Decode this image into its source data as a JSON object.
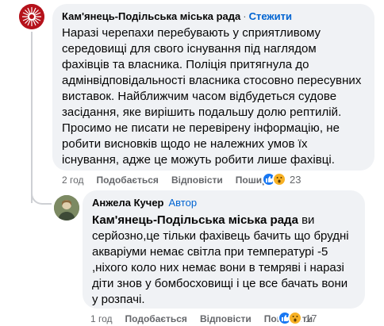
{
  "comment": {
    "author": "Кам'янець-Подільська міська рада",
    "follow_label": "Стежити",
    "separator": "·",
    "text": "Наразі черепахи перебувають у сприятливому середовищі для свого існування під наглядом фахівців та власника. Поліція притягнула до адмінвідповідальності власника стосовно пересувних виставок. Найближчим часом відбудеться судове засідання, яке вирішить подальшу долю рептилій. Просимо не писати не перевірену інформацію, не робити висновків щодо не належних умов їх існування, адже це можуть робити лише фахівці.",
    "time": "2 год",
    "like_label": "Подобається",
    "reply_label": "Відповісти",
    "share_label": "Поширити",
    "reactions_count": "23",
    "reaction_icons": [
      "like-icon",
      "wow-icon"
    ]
  },
  "reply": {
    "author": "Анжела Кучер",
    "author_badge": "Автор",
    "mention": "Кам'янець-Подільська міська рада",
    "text": " ви серйозно,це тільки фахівець бачить що брудні акваріуми немає світла при температурі -5 ,ніхого коло них немає вони в темряві і наразі діти знов у бомбосховищі і це все бачать вони у розпачі.",
    "time": "1 год",
    "like_label": "Подобається",
    "reply_label": "Відповісти",
    "share_label": "Поширити",
    "reactions_count": "17",
    "reaction_icons": [
      "like-icon",
      "wow-icon"
    ]
  },
  "colors": {
    "bubble": "#f0f2f5",
    "link": "#0064d1",
    "meta": "#65676b",
    "org_avatar": "#b5121b"
  }
}
